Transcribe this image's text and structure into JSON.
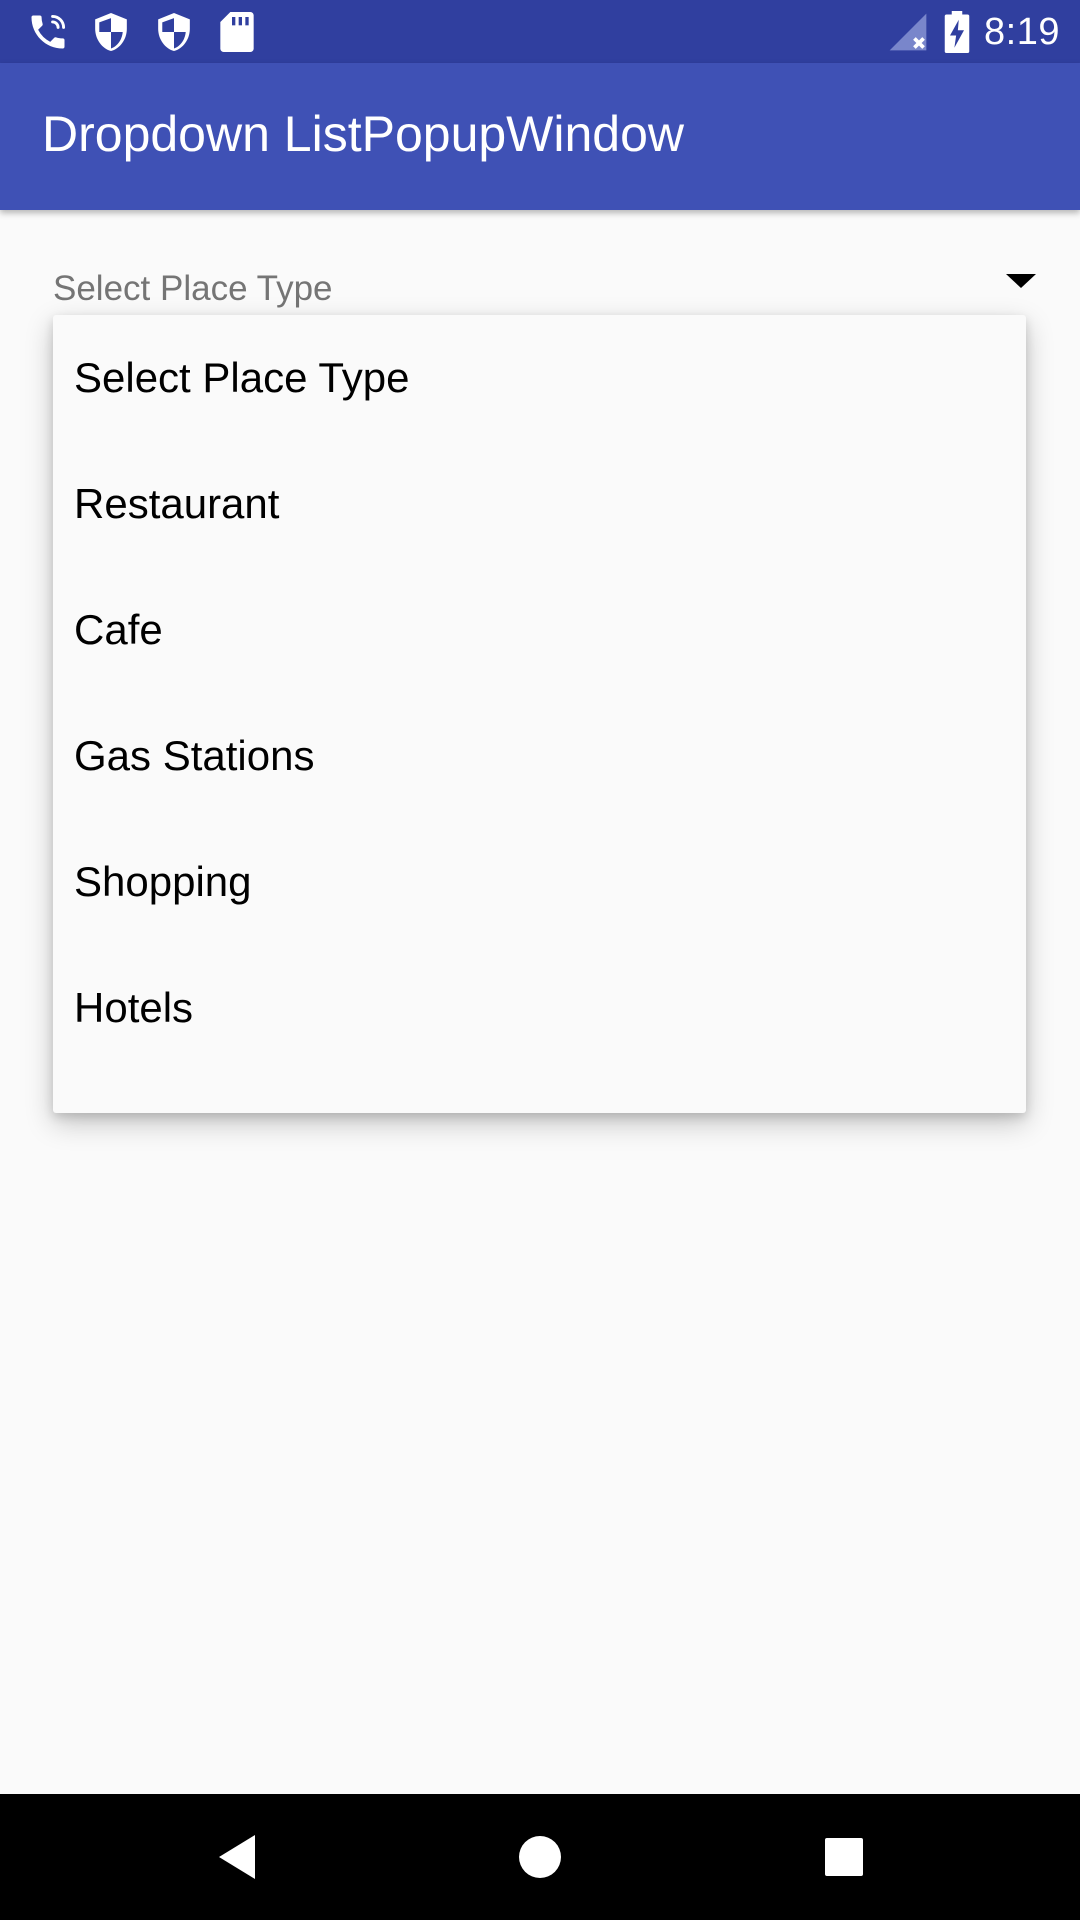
{
  "status_bar": {
    "time": "8:19",
    "left_icons": [
      "call-wifi-icon",
      "shield-icon",
      "shield-icon",
      "sd-card-icon"
    ],
    "right_icons": [
      "signal-no-service-icon",
      "battery-charging-icon"
    ]
  },
  "app_bar": {
    "title": "Dropdown ListPopupWindow",
    "color": "#3f51b5",
    "status_color": "#303f9f"
  },
  "spinner": {
    "selected_text": "Select Place Type",
    "arrow_icon": "arrow-drop-down-icon"
  },
  "popup": {
    "items": [
      {
        "label": "Select Place Type"
      },
      {
        "label": "Restaurant"
      },
      {
        "label": "Cafe"
      },
      {
        "label": "Gas Stations"
      },
      {
        "label": "Shopping"
      },
      {
        "label": "Hotels"
      }
    ]
  },
  "nav_bar": {
    "buttons": [
      "back-icon",
      "home-icon",
      "recents-icon"
    ]
  }
}
